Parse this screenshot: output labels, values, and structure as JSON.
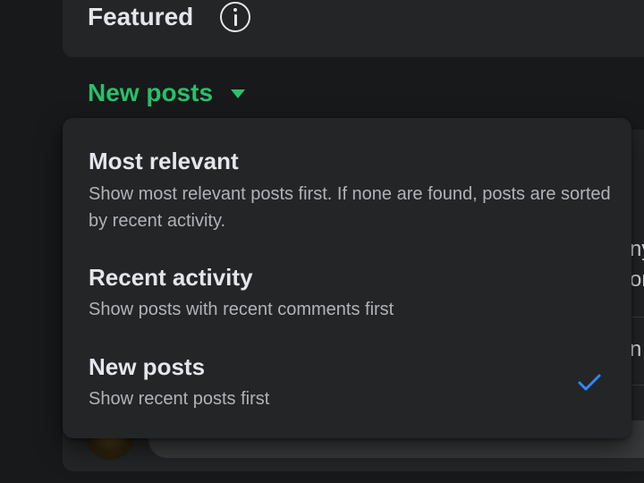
{
  "featured": {
    "title": "Featured",
    "icon": "info-icon"
  },
  "sort": {
    "current_label": "New posts",
    "accent_color": "#2abf6b",
    "options": [
      {
        "title": "Most relevant",
        "description": "Show most relevant posts first. If none are found, posts are sorted by recent activity.",
        "selected": false
      },
      {
        "title": "Recent activity",
        "description": "Show posts with recent comments first",
        "selected": false
      },
      {
        "title": "New posts",
        "description": "Show recent posts first",
        "selected": true
      }
    ],
    "check_color": "#2d88ff"
  },
  "background_feed": {
    "snippet_lines": [
      "ny",
      "or",
      "n"
    ]
  }
}
